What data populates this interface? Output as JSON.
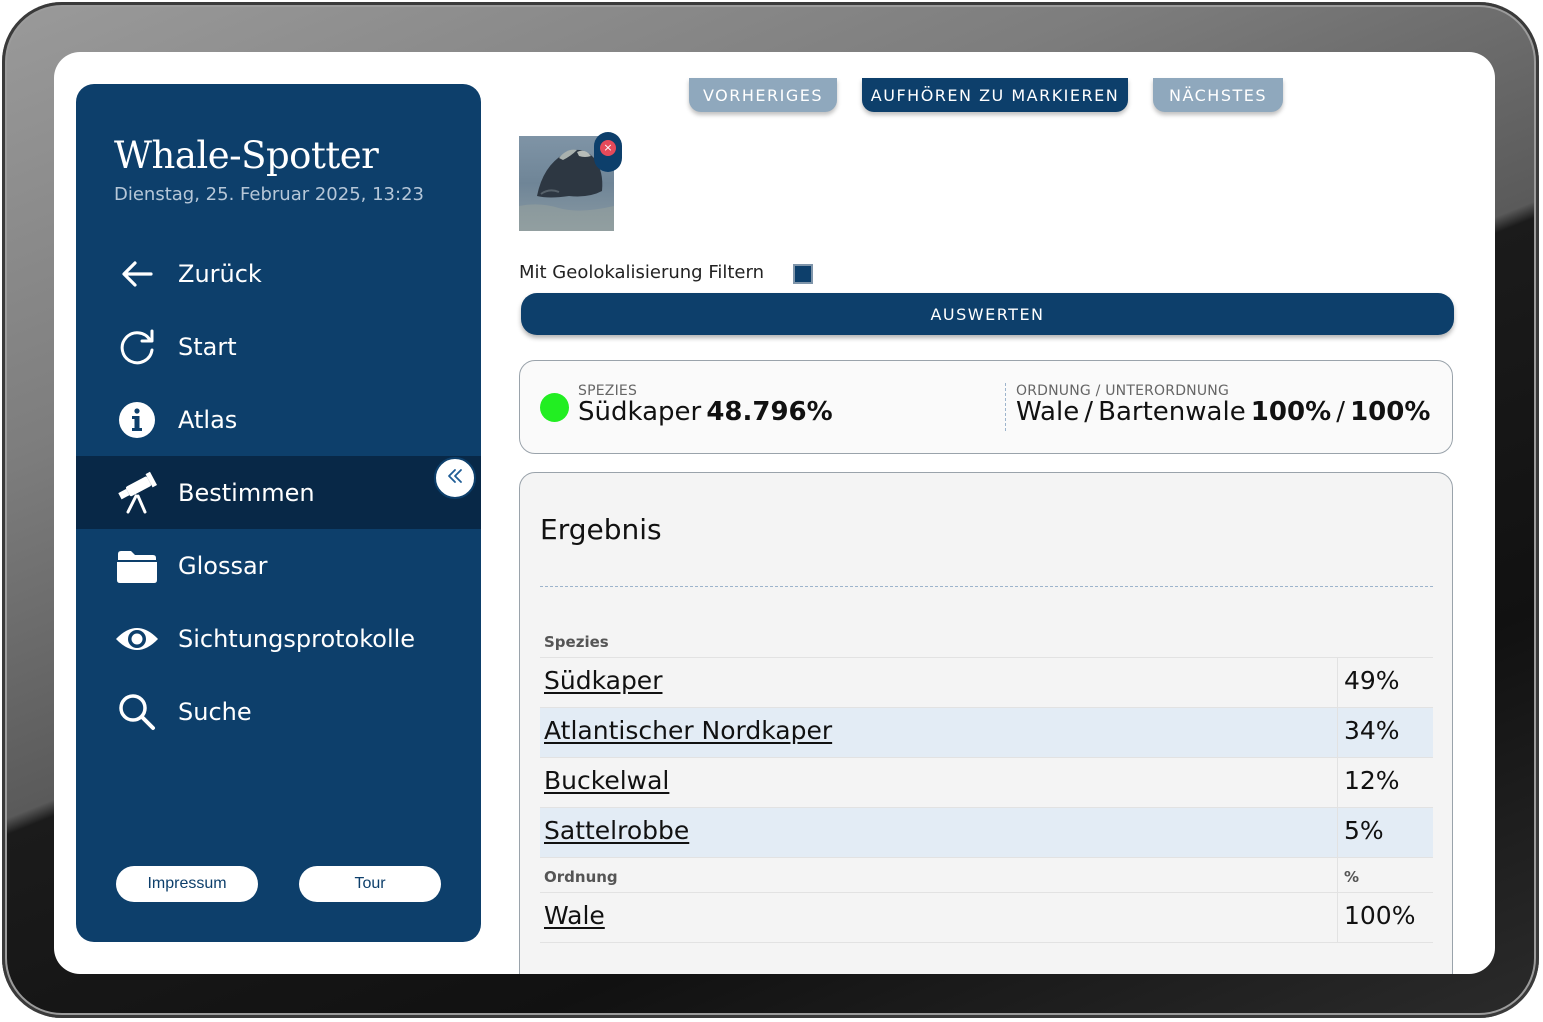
{
  "app": {
    "title": "Whale-Spotter",
    "date": "Dienstag, 25. Februar 2025, 13:23"
  },
  "sidebar": {
    "items": [
      {
        "label": "Zurück",
        "icon": "arrow-left-icon"
      },
      {
        "label": "Start",
        "icon": "refresh-icon"
      },
      {
        "label": "Atlas",
        "icon": "info-icon"
      },
      {
        "label": "Bestimmen",
        "icon": "telescope-icon",
        "active": true
      },
      {
        "label": "Glossar",
        "icon": "folder-icon"
      },
      {
        "label": "Sichtungsprotokolle",
        "icon": "eye-icon"
      },
      {
        "label": "Suche",
        "icon": "search-icon"
      }
    ],
    "footer": {
      "impressum": "Impressum",
      "tour": "Tour"
    }
  },
  "toolbar": {
    "prev": "VORHERIGES",
    "stop": "AUFHÖREN ZU MARKIEREN",
    "next": "NÄCHSTES"
  },
  "filter": {
    "geo_label": "Mit Geolokalisierung Filtern",
    "geo_checked": true
  },
  "evaluate_label": "AUSWERTEN",
  "summary": {
    "species_caption": "SPEZIES",
    "species_name": "Südkaper",
    "species_value": "48.796%",
    "status_color": "#22ee22",
    "order_caption": "ORDNUNG",
    "suborder_caption": "UNTERORDNUNG",
    "order_name": "Wale",
    "suborder_name": "Bartenwale",
    "order_value": "100%",
    "suborder_value": "100%",
    "slash": "/"
  },
  "result": {
    "title": "Ergebnis",
    "species_header": "Spezies",
    "species_rows": [
      {
        "name": "Südkaper",
        "value": "49%"
      },
      {
        "name": "Atlantischer Nordkaper",
        "value": "34%"
      },
      {
        "name": "Buckelwal",
        "value": "12%"
      },
      {
        "name": "Sattelrobbe",
        "value": "5%"
      }
    ],
    "order_header": "Ordnung",
    "order_pct_header": "%",
    "order_rows": [
      {
        "name": "Wale",
        "value": "100%"
      }
    ]
  },
  "colors": {
    "primary": "#0d3f6b",
    "active": "#082847",
    "disabled_button": "#8fa8bd",
    "row_alt": "#e3ecf5"
  }
}
